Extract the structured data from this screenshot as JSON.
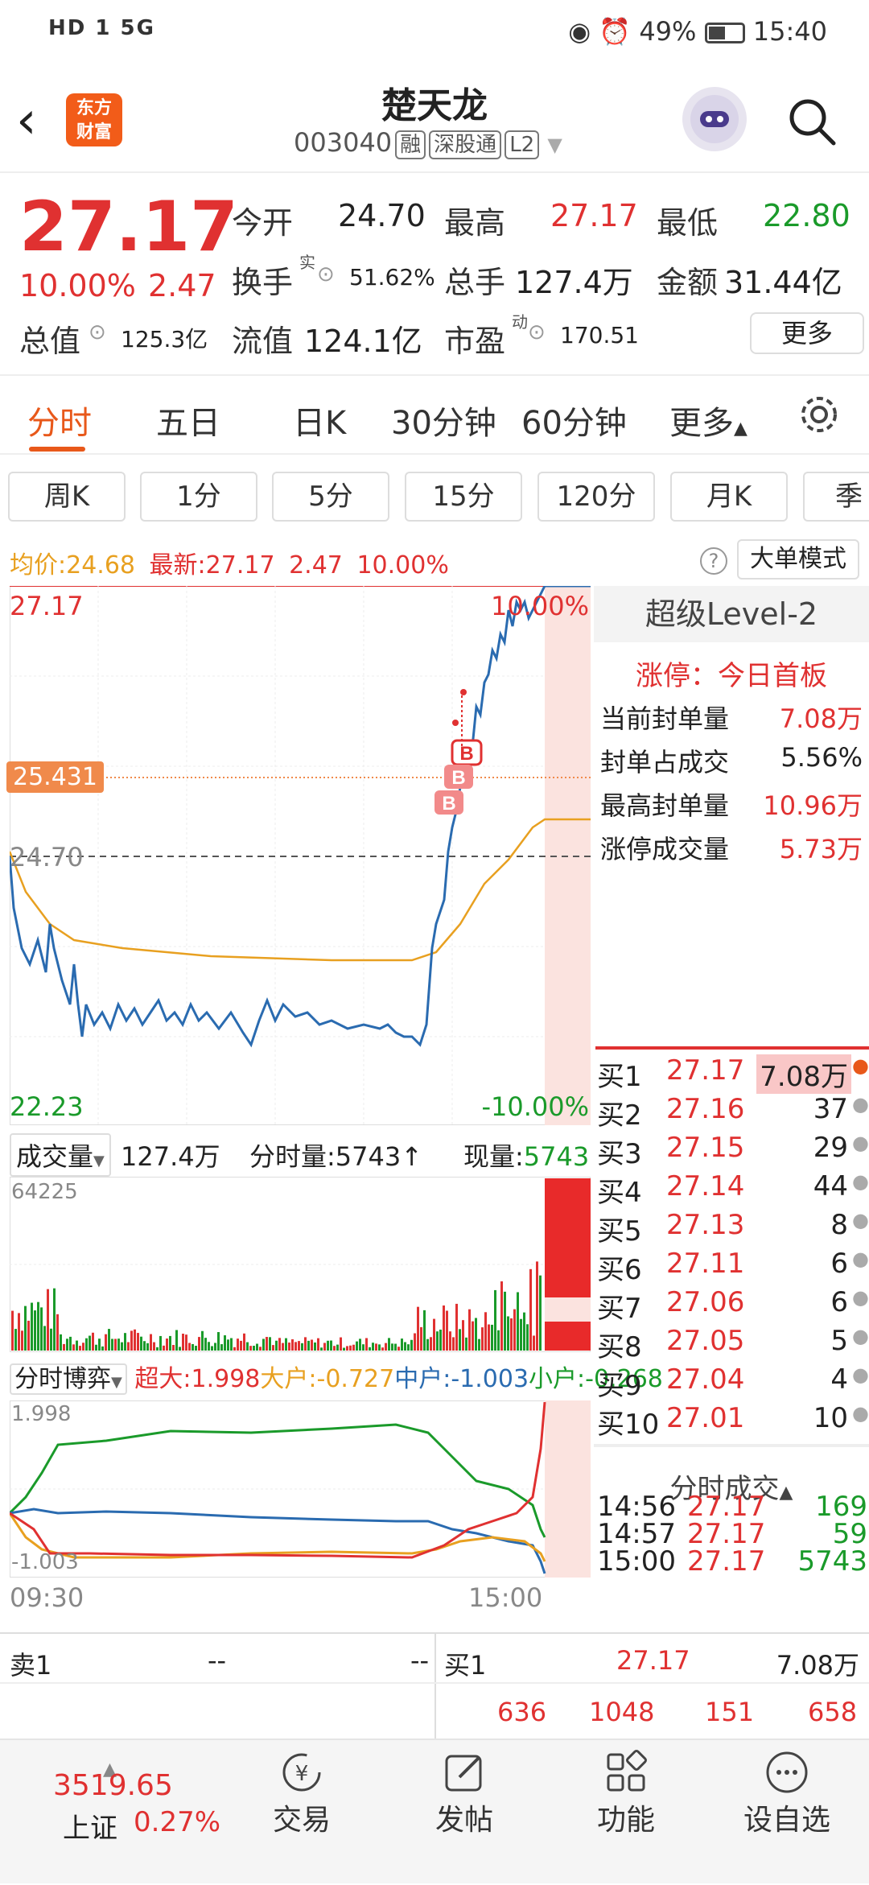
{
  "status_bar": {
    "network": "HD 1 5G",
    "battery": "49%",
    "time": "15:40"
  },
  "header": {
    "logo_top": "东方",
    "logo_bottom": "财富",
    "stock_name": "楚天龙",
    "stock_code": "003040",
    "tags": [
      "融",
      "深股通",
      "L2"
    ]
  },
  "quote": {
    "price": "27.17",
    "change_pct": "10.00%",
    "change": "2.47",
    "open_label": "今开",
    "open": "24.70",
    "high_label": "最高",
    "high": "27.17",
    "low_label": "最低",
    "low": "22.80",
    "turnover_label": "换手",
    "turnover_sup": "实",
    "turnover": "51.62%",
    "volume_label": "总手",
    "volume": "127.4万",
    "amount_label": "金额",
    "amount": "31.44亿",
    "mktcap_label": "总值",
    "mktcap": "125.3亿",
    "float_label": "流值",
    "float": "124.1亿",
    "pe_label": "市盈",
    "pe_sup": "动",
    "pe": "170.51",
    "more": "更多"
  },
  "tabs": [
    "分时",
    "五日",
    "日K",
    "30分钟",
    "60分钟",
    "更多"
  ],
  "periods": [
    "周K",
    "1分",
    "5分",
    "15分",
    "120分",
    "月K",
    "季"
  ],
  "info_line": {
    "avg_label": "均价:",
    "avg": "24.68",
    "latest_label": "最新:",
    "latest": "27.17",
    "chg": "2.47",
    "pct": "10.00%",
    "mode_btn": "大单模式"
  },
  "chart_labels": {
    "top_price": "27.17",
    "top_pct": "10.00%",
    "cursor_price": "25.431",
    "mid_price": "24.70",
    "bottom_price": "22.23",
    "bottom_pct": "-10.00%",
    "b_marker": "B"
  },
  "volume_bar": {
    "label": "成交量",
    "total": "127.4万",
    "fen_label": "分时量:5743",
    "now_label": "现量:",
    "now": "5743",
    "max": "64225"
  },
  "bopai": {
    "label": "分时博弈",
    "super_label": "超大:",
    "super": "1.998",
    "big_label": "大户:",
    "big": "-0.727",
    "mid_label": "中户:",
    "mid": "-1.003",
    "small_label": "小户:",
    "small": "-0.268",
    "max": "1.998",
    "min": "-1.003"
  },
  "time_axis": {
    "start": "09:30",
    "end": "15:00"
  },
  "level2": {
    "title": "超级Level-2",
    "limit_label": "涨停：今日首板",
    "rows": [
      {
        "k": "当前封单量",
        "v": "7.08万"
      },
      {
        "k": "封单占成交",
        "v": "5.56%"
      },
      {
        "k": "最高封单量",
        "v": "10.96万"
      },
      {
        "k": "涨停成交量",
        "v": "5.73万"
      }
    ]
  },
  "bids": [
    {
      "n": "买1",
      "p": "27.17",
      "v": "7.08万"
    },
    {
      "n": "买2",
      "p": "27.16",
      "v": "37"
    },
    {
      "n": "买3",
      "p": "27.15",
      "v": "29"
    },
    {
      "n": "买4",
      "p": "27.14",
      "v": "44"
    },
    {
      "n": "买5",
      "p": "27.13",
      "v": "8"
    },
    {
      "n": "买6",
      "p": "27.11",
      "v": "6"
    },
    {
      "n": "买7",
      "p": "27.06",
      "v": "6"
    },
    {
      "n": "买8",
      "p": "27.05",
      "v": "5"
    },
    {
      "n": "买9",
      "p": "27.04",
      "v": "4"
    },
    {
      "n": "买10",
      "p": "27.01",
      "v": "10"
    }
  ],
  "trades_title": "分时成交",
  "trades": [
    {
      "t": "14:56",
      "p": "27.17",
      "v": "169"
    },
    {
      "t": "14:57",
      "p": "27.17",
      "v": "59"
    },
    {
      "t": "15:00",
      "p": "27.17",
      "v": "5743"
    }
  ],
  "bottom_table": {
    "sell_label": "卖1",
    "sell_p": "--",
    "sell_v": "--",
    "buy_label": "买1",
    "buy_p": "27.17",
    "buy_v": "7.08万",
    "row2": [
      "636",
      "1048",
      "151",
      "658"
    ]
  },
  "nav": {
    "index_value": "3519.65",
    "index_name": "上证",
    "index_pct": "0.27%",
    "items": [
      "交易",
      "发帖",
      "功能",
      "设自选"
    ]
  },
  "colors": {
    "up": "#e03131",
    "down": "#1a9a2a",
    "accent": "#e8581a",
    "avg": "#e8a020",
    "price_line": "#2a6bb0"
  }
}
